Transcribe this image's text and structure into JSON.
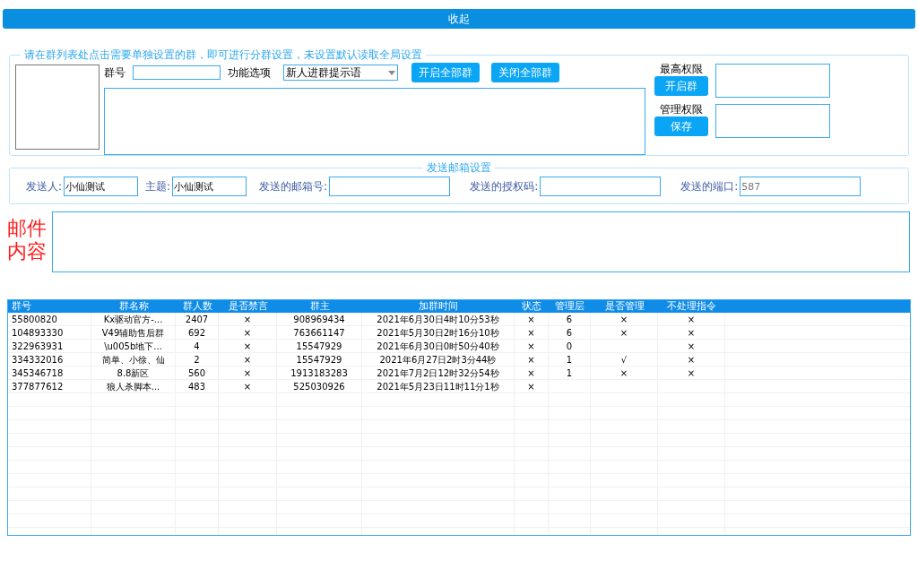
{
  "collapse_button": "收起",
  "group_settings": {
    "legend": "请在群列表处点击需要单独设置的群，即可进行分群设置，未设置默认读取全局设置",
    "group_number_label": "群号",
    "function_label": "功能选项",
    "function_value": "新人进群提示语",
    "buttons": [
      "开启全部群",
      "关闭全部群"
    ],
    "permissions": [
      {
        "label": "最高权限",
        "button": "开启群"
      },
      {
        "label": "管理权限",
        "button": "保存"
      }
    ]
  },
  "mail_settings": {
    "legend": "发送邮箱设置",
    "fields": [
      {
        "label": "发送人:",
        "value": "小仙测试"
      },
      {
        "label": "主题:",
        "value": "小仙测试"
      },
      {
        "label": "发送的邮箱号:"
      },
      {
        "label": "发送的授权码:"
      },
      {
        "label": "发送的端口:",
        "placeholder": "587"
      }
    ]
  },
  "mail_content_label": [
    "邮件",
    "内容"
  ],
  "table": {
    "columns": [
      "群号",
      "群名称",
      "群人数",
      "是否禁言",
      "群主",
      "加群时间",
      "状态",
      "管理层",
      "是否管理",
      "不处理指令"
    ],
    "rows": [
      [
        "55800820",
        "Kx驱动官方-...",
        "2407",
        "×",
        "908969434",
        "2021年6月30日4时10分53秒",
        "×",
        "6",
        "×",
        "×"
      ],
      [
        "104893330",
        "V49辅助售后群",
        "692",
        "×",
        "763661147",
        "2021年5月30日2时16分10秒",
        "×",
        "6",
        "×",
        "×"
      ],
      [
        "322963931",
        "\\u005b地下...",
        "4",
        "×",
        "15547929",
        "2021年6月30日0时50分40秒",
        "×",
        "0",
        null,
        "×"
      ],
      [
        "334332016",
        "简单、小徐、仙",
        "2",
        "×",
        "15547929",
        "2021年6月27日2时3分44秒",
        "×",
        "1",
        "√",
        "×"
      ],
      [
        "345346718",
        "8.8新区",
        "560",
        "×",
        "1913183283",
        "2021年7月2日12时32分54秒",
        "×",
        "1",
        "×",
        "×"
      ],
      [
        "377877612",
        "狼人杀脚本...",
        "483",
        "×",
        "525030926",
        "2021年5月23日11时11分1秒",
        "×",
        null,
        null,
        null
      ]
    ]
  }
}
